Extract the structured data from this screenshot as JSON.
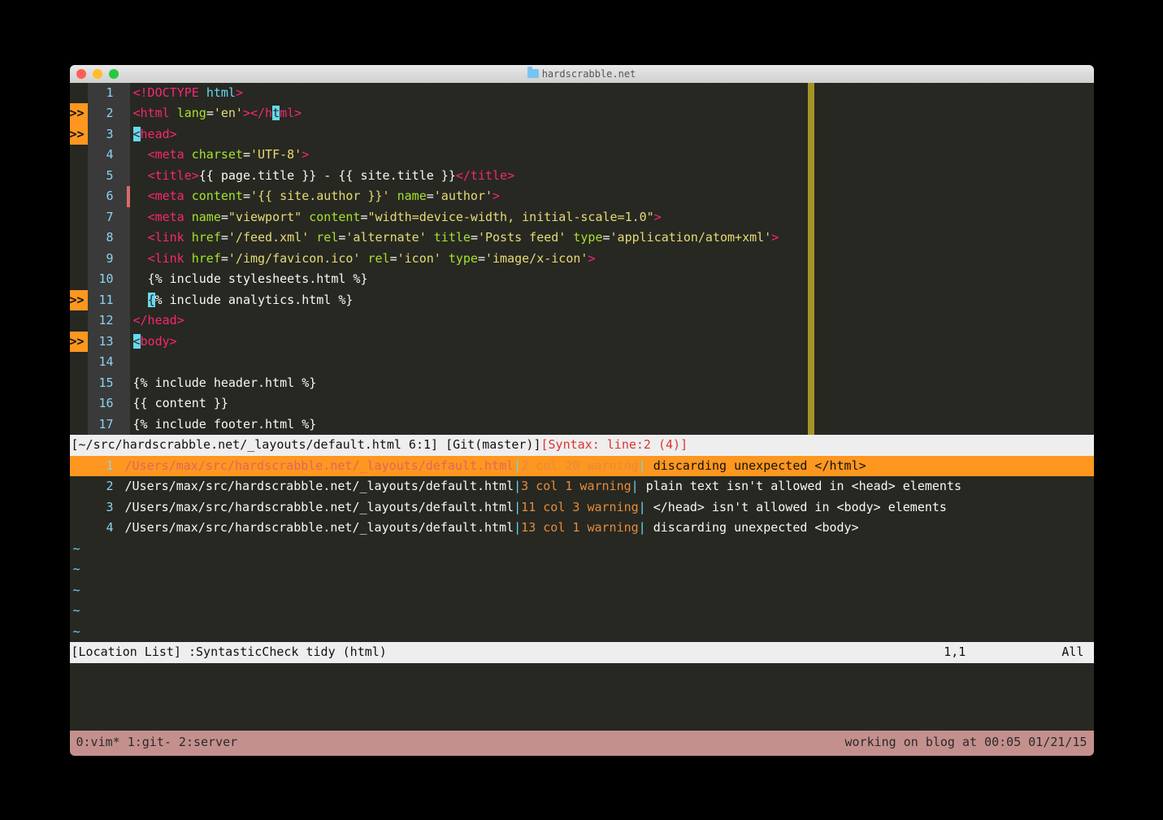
{
  "window": {
    "title": "hardscrabble.net"
  },
  "code_lines": [
    {
      "num": "1",
      "sign": "",
      "bar": "",
      "html": "<span class='c-tag'>&lt;!DOCTYPE</span> <span class='c-kw'>html</span><span class='c-tag'>&gt;</span>"
    },
    {
      "num": "2",
      "sign": ">>",
      "bar": "",
      "html": "<span class='c-tag'>&lt;html</span> <span class='c-attr'>lang</span>=<span class='c-str'>'en'</span><span class='c-tag'>&gt;&lt;/h</span><span class='hl-cyan'>t</span><span class='c-tag'>ml&gt;</span>"
    },
    {
      "num": "3",
      "sign": ">>",
      "bar": "",
      "html": "<span class='hl-cyan'>&lt;</span><span class='c-tag'>head&gt;</span>"
    },
    {
      "num": "4",
      "sign": "",
      "bar": "",
      "html": "  <span class='c-tag'>&lt;meta</span> <span class='c-attr'>charset</span>=<span class='c-str'>'UTF-8'</span><span class='c-tag'>&gt;</span>"
    },
    {
      "num": "5",
      "sign": "",
      "bar": "",
      "html": "  <span class='c-tag'>&lt;title&gt;</span><span class='c-txt'>{{ page.title }} - {{ site.title }}</span><span class='c-tag'>&lt;/title&gt;</span>"
    },
    {
      "num": "6",
      "sign": "",
      "bar": "red",
      "html": "  <span class='c-tag'>&lt;meta</span> <span class='c-attr'>content</span>=<span class='c-str'>'{{ site.author }}'</span> <span class='c-attr'>name</span>=<span class='c-str'>'author'</span><span class='c-tag'>&gt;</span>"
    },
    {
      "num": "7",
      "sign": "",
      "bar": "",
      "html": "  <span class='c-tag'>&lt;meta</span> <span class='c-attr'>name</span>=<span class='c-str'>\"viewport\"</span> <span class='c-attr'>content</span>=<span class='c-str'>\"width=device-width, initial-scale=1.0\"</span><span class='c-tag'>&gt;</span>"
    },
    {
      "num": "8",
      "sign": "",
      "bar": "",
      "html": "  <span class='c-tag'>&lt;link</span> <span class='c-attr'>href</span>=<span class='c-str'>'/feed.xml'</span> <span class='c-attr'>rel</span>=<span class='c-str'>'alternate'</span> <span class='c-attr'>title</span>=<span class='c-str'>'Posts feed'</span> <span class='c-attr'>type</span>=<span class='c-str'>'application/atom+xml'</span><span class='c-tag'>&gt;</span>"
    },
    {
      "num": "9",
      "sign": "",
      "bar": "",
      "html": "  <span class='c-tag'>&lt;link</span> <span class='c-attr'>href</span>=<span class='c-str'>'/img/favicon.ico'</span> <span class='c-attr'>rel</span>=<span class='c-str'>'icon'</span> <span class='c-attr'>type</span>=<span class='c-str'>'image/x-icon'</span><span class='c-tag'>&gt;</span>"
    },
    {
      "num": "10",
      "sign": "",
      "bar": "",
      "html": "  <span class='c-txt'>{% include stylesheets.html %}</span>"
    },
    {
      "num": "11",
      "sign": ">>",
      "bar": "",
      "html": "  <span class='hl-cyan'>{</span><span class='c-txt'>% include analytics.html %}</span>"
    },
    {
      "num": "12",
      "sign": "",
      "bar": "",
      "html": "<span class='c-tag'>&lt;/head&gt;</span>"
    },
    {
      "num": "13",
      "sign": ">>",
      "bar": "",
      "html": "<span class='hl-cyan'>&lt;</span><span class='c-tag'>body&gt;</span>"
    },
    {
      "num": "14",
      "sign": "",
      "bar": "",
      "html": ""
    },
    {
      "num": "15",
      "sign": "",
      "bar": "",
      "html": "<span class='c-txt'>{% include header.html %}</span>"
    },
    {
      "num": "16",
      "sign": "",
      "bar": "",
      "html": "<span class='c-txt'>{{ content }}</span>"
    },
    {
      "num": "17",
      "sign": "",
      "bar": "",
      "html": "<span class='c-txt'>{% include footer.html %}</span>"
    }
  ],
  "statusline": {
    "path": "[~/src/hardscrabble.net/_layouts/default.html 6:1]",
    "git": " [Git(master)]",
    "syntax": "[Syntax: line:2 (4)]"
  },
  "loclist": [
    {
      "num": "1",
      "sel": true,
      "path": "/Users/max/src/hardscrabble.net/_layouts/default.html",
      "loc": "2 col 20 warning",
      "msg": " discarding unexpected </html>"
    },
    {
      "num": "2",
      "sel": false,
      "path": "/Users/max/src/hardscrabble.net/_layouts/default.html",
      "loc": "3 col 1 warning",
      "msg": " plain text isn't allowed in <head> elements"
    },
    {
      "num": "3",
      "sel": false,
      "path": "/Users/max/src/hardscrabble.net/_layouts/default.html",
      "loc": "11 col 3 warning",
      "msg": " </head> isn't allowed in <body> elements"
    },
    {
      "num": "4",
      "sel": false,
      "path": "/Users/max/src/hardscrabble.net/_layouts/default.html",
      "loc": "13 col 1 warning",
      "msg": " discarding unexpected <body>"
    }
  ],
  "tildes": 5,
  "locstatus": {
    "left": "[Location List] :SyntasticCheck tidy (html)",
    "pos": "1,1",
    "pct": "All"
  },
  "tmux": {
    "left": "0:vim* 1:git- 2:server",
    "right": "working on blog at 00:05 01/21/15"
  }
}
